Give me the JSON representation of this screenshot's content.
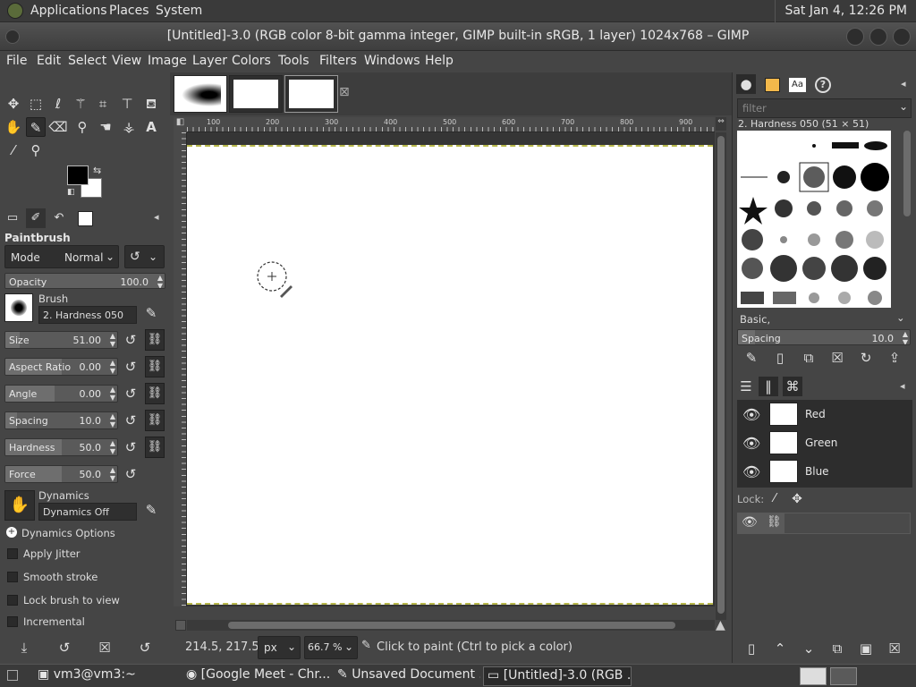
{
  "top_panel": {
    "menus": [
      "Applications",
      "Places",
      "System"
    ],
    "clock": "Sat Jan  4, 12:26 PM"
  },
  "window": {
    "title": "[Untitled]-3.0 (RGB color 8-bit gamma integer, GIMP built-in sRGB, 1 layer) 1024x768 – GIMP"
  },
  "menubar": [
    "File",
    "Edit",
    "Select",
    "View",
    "Image",
    "Layer",
    "Colors",
    "Tools",
    "Filters",
    "Windows",
    "Help"
  ],
  "tool_options": {
    "tool_name": "Paintbrush",
    "mode_label": "Mode",
    "mode_value": "Normal",
    "opacity_label": "Opacity",
    "opacity_value": "100.0",
    "brush_label": "Brush",
    "brush_name": "2. Hardness 050",
    "size_label": "Size",
    "size_value": "51.00",
    "aspect_label": "Aspect Ratio",
    "aspect_value": "0.00",
    "angle_label": "Angle",
    "angle_value": "0.00",
    "spacing_label": "Spacing",
    "spacing_value": "10.0",
    "hardness_label": "Hardness",
    "hardness_value": "50.0",
    "force_label": "Force",
    "force_value": "50.0",
    "dynamics_label": "Dynamics",
    "dynamics_value": "Dynamics Off",
    "dynamics_options": "Dynamics Options",
    "apply_jitter": "Apply Jitter",
    "smooth_stroke": "Smooth stroke",
    "lock_brush": "Lock brush to view",
    "incremental": "Incremental"
  },
  "ruler": {
    "ticks": [
      "100",
      "200",
      "300",
      "400",
      "500",
      "600",
      "700",
      "800",
      "900"
    ]
  },
  "statusbar": {
    "coords": "214.5, 217.5",
    "unit": "px",
    "zoom": "66.7 %",
    "message": "Click to paint (Ctrl to pick a color)"
  },
  "brushes_panel": {
    "filter_placeholder": "filter",
    "selected_brush": "2. Hardness 050 (51 × 51)",
    "tag": "Basic,",
    "spacing_label": "Spacing",
    "spacing_value": "10.0"
  },
  "layers_panel": {
    "channels": [
      {
        "name": "Red"
      },
      {
        "name": "Green"
      },
      {
        "name": "Blue"
      }
    ],
    "lock_label": "Lock:"
  },
  "taskbar": [
    {
      "label": "vm3@vm3:~"
    },
    {
      "label": "[Google Meet - Chr..."
    },
    {
      "label": "Unsaved Document ..."
    },
    {
      "label": "[Untitled]-3.0 (RGB ..."
    }
  ]
}
